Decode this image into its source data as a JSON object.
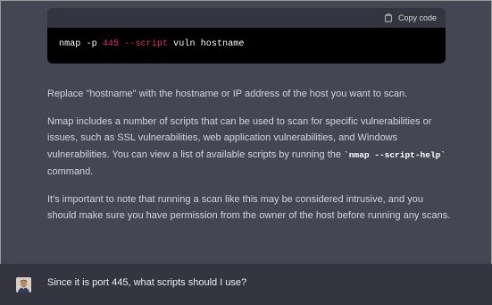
{
  "code_block": {
    "copy_label": "Copy code",
    "command": {
      "cmd": "nmap",
      "flag_p": "-p",
      "port": "445",
      "flag_script": "--script",
      "script": "vuln",
      "target": "hostname"
    }
  },
  "answer": {
    "p1": "Replace \"hostname\" with the hostname or IP address of the host you want to scan.",
    "p2_before": "Nmap includes a number of scripts that can be used to scan for specific vulnerabilities or issues, such as SSL vulnerabilities, web application vulnerabilities, and Windows vulnerabilities. You can view a list of available scripts by running the ",
    "p2_code": "`nmap --script-help`",
    "p2_after": " command.",
    "p3": "It's important to note that running a scan like this may be considered intrusive, and you should make sure you have permission from the owner of the host before running any scans."
  },
  "user_message": {
    "text": "Since it is port 445, what scripts should I use?"
  },
  "colors": {
    "assistant_bg": "#444654",
    "user_bg": "#343541",
    "code_bg": "#000000",
    "accent_token": "#df3079"
  }
}
